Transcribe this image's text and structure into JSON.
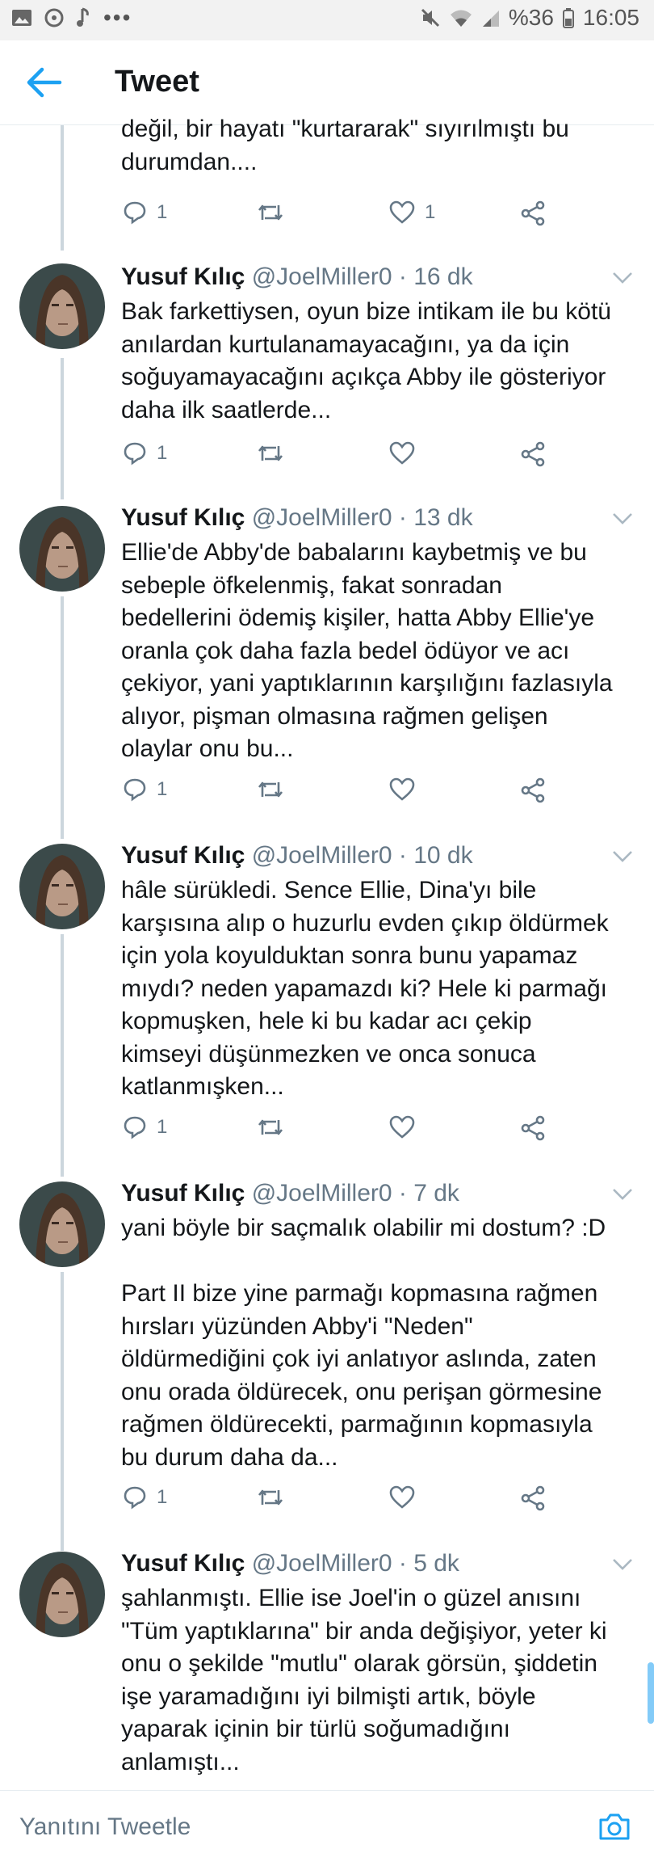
{
  "status_bar": {
    "battery": "%36",
    "time": "16:05"
  },
  "header": {
    "title": "Tweet"
  },
  "top_fragment": {
    "text": "değil, bir hayatı \"kurtararak\" sıyırılmıştı bu\ndurumdan....",
    "reply_count": "1",
    "like_count": "1"
  },
  "tweets": [
    {
      "name": "Yusuf Kılıç",
      "handle": "@JoelMiller0",
      "time": "· 16 dk",
      "text": "Bak farkettiysen, oyun bize intikam ile bu kötü\nanılardan kurtulanamayacağını, ya da için\nsoğuyamayacağını açıkça Abby ile gösteriyor\ndaha ilk saatlerde...",
      "reply_count": "1"
    },
    {
      "name": "Yusuf Kılıç",
      "handle": "@JoelMiller0",
      "time": "· 13 dk",
      "text": "Ellie'de Abby'de babalarını kaybetmiş ve bu\nsebeple öfkelenmiş, fakat sonradan\nbedellerini ödemiş kişiler, hatta Abby Ellie'ye\noranla çok daha fazla bedel ödüyor ve acı\nçekiyor, yani yaptıklarının karşılığını fazlasıyla\nalıyor, pişman olmasına rağmen gelişen\nolaylar onu bu...",
      "reply_count": "1"
    },
    {
      "name": "Yusuf Kılıç",
      "handle": "@JoelMiller0",
      "time": "· 10 dk",
      "text": "hâle sürükledi. Sence Ellie, Dina'yı bile\nkarşısına alıp o huzurlu evden çıkıp öldürmek\niçin yola koyulduktan sonra bunu yapamaz\nmıydı? neden yapamazdı ki? Hele ki parmağı\nkopmuşken, hele ki bu kadar acı çekip\nkimseyi düşünmezken ve onca sonuca\nkatlanmışken...",
      "reply_count": "1"
    },
    {
      "name": "Yusuf Kılıç",
      "handle": "@JoelMiller0",
      "time": "· 7 dk",
      "text": "yani böyle bir saçmalık olabilir mi dostum? :D\n\nPart II bize yine parmağı kopmasına rağmen\nhırsları yüzünden Abby'i \"Neden\"\nöldürmediğini çok iyi anlatıyor aslında, zaten\nonu orada öldürecek, onu perişan görmesine\nrağmen öldürecekti, parmağının kopmasıyla\nbu durum daha da...",
      "reply_count": "1"
    },
    {
      "name": "Yusuf Kılıç",
      "handle": "@JoelMiller0",
      "time": "· 5 dk",
      "text": "şahlanmıştı. Ellie ise Joel'in o güzel anısını\n\"Tüm yaptıklarına\" bir anda değişiyor, yeter ki\nonu o şekilde \"mutlu\" olarak görsün, şiddetin\nişe yaramadığını iyi bilmişti artık, böyle\nyaparak içinin bir türlü soğumadığını\nanlamıştı...",
      "reply_count": ""
    }
  ],
  "reply_bar": {
    "placeholder": "Yanıtını Tweetle"
  },
  "colors": {
    "accent": "#1da1f2",
    "secondary_text": "#657786",
    "thread_line": "#ccd6dd"
  }
}
